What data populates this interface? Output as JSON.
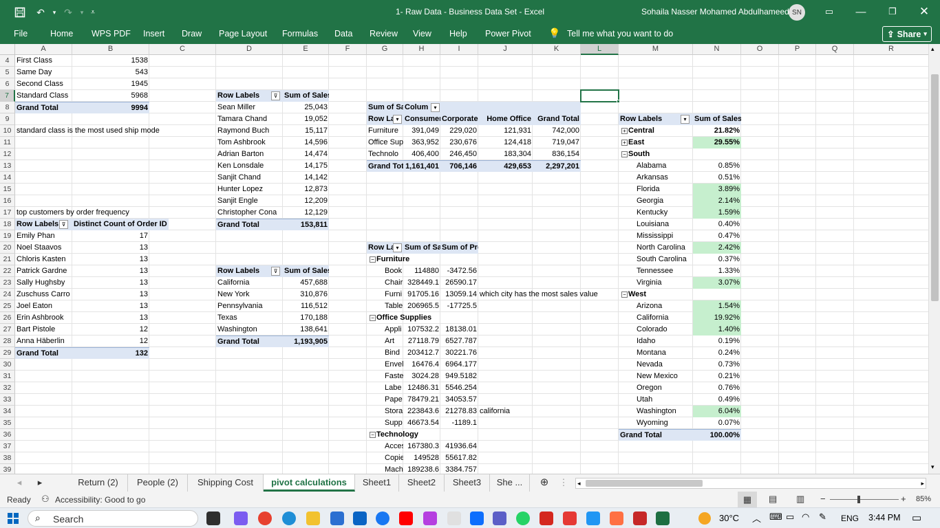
{
  "app": {
    "title": "1- Raw Data - Business Data Set  -  Excel",
    "user": "Sohaila Nasser Mohamed Abdulhameed",
    "user_initials": "SN",
    "accent": "#217346"
  },
  "menu": [
    "File",
    "Home",
    "WPS PDF",
    "Insert",
    "Draw",
    "Page Layout",
    "Formulas",
    "Data",
    "Review",
    "View",
    "Help",
    "Power Pivot"
  ],
  "tell_me": "Tell me what you want to do",
  "share_label": "Share",
  "columns": [
    "A",
    "B",
    "C",
    "D",
    "E",
    "F",
    "G",
    "H",
    "I",
    "J",
    "K",
    "L",
    "M",
    "N",
    "O",
    "P",
    "Q",
    "R"
  ],
  "rows": [
    "4",
    "5",
    "6",
    "7",
    "8",
    "9",
    "10",
    "11",
    "12",
    "13",
    "14",
    "15",
    "16",
    "17",
    "18",
    "19",
    "20",
    "21",
    "22",
    "23",
    "24",
    "25",
    "26",
    "27",
    "28",
    "29",
    "30",
    "31",
    "32",
    "33",
    "34",
    "35",
    "36",
    "37",
    "38",
    "39"
  ],
  "ship": {
    "rows": [
      [
        "First Class",
        "1538"
      ],
      [
        "Same Day",
        "543"
      ],
      [
        "Second Class",
        "1945"
      ],
      [
        "Standard Class",
        "5968"
      ]
    ],
    "total": [
      "Grand Total",
      "9994"
    ],
    "note": "standard class is the most used ship mode"
  },
  "orders": {
    "note": "top customers by order frequency",
    "header": [
      "Row Labels",
      "Distinct Count of Order ID"
    ],
    "rows": [
      [
        "Emily Phan",
        "17"
      ],
      [
        "Noel Staavos",
        "13"
      ],
      [
        "Chloris Kasten",
        "13"
      ],
      [
        "Patrick Gardne",
        "13"
      ],
      [
        "Sally Hughsby",
        "13"
      ],
      [
        "Zuschuss Carro",
        "13"
      ],
      [
        "Joel Eaton",
        "13"
      ],
      [
        "Erin Ashbrook",
        "13"
      ],
      [
        "Bart Pistole",
        "12"
      ],
      [
        "Anna Häberlin",
        "12"
      ]
    ],
    "total": [
      "Grand Total",
      "132"
    ]
  },
  "customers": {
    "header": [
      "Row Labels",
      "Sum of Sales"
    ],
    "rows": [
      [
        "Sean Miller",
        "25,043"
      ],
      [
        "Tamara Chand",
        "19,052"
      ],
      [
        "Raymond Buch",
        "15,117"
      ],
      [
        "Tom Ashbrook",
        "14,596"
      ],
      [
        "Adrian Barton",
        "14,474"
      ],
      [
        "Ken Lonsdale",
        "14,175"
      ],
      [
        "Sanjit Chand",
        "14,142"
      ],
      [
        "Hunter Lopez",
        "12,873"
      ],
      [
        "Sanjit Engle",
        "12,209"
      ],
      [
        "Christopher Cona",
        "12,129"
      ]
    ],
    "total": [
      "Grand Total",
      "153,811"
    ]
  },
  "states": {
    "header": [
      "Row Labels",
      "Sum of Sales"
    ],
    "rows": [
      [
        "California",
        "457,688"
      ],
      [
        "New York",
        "310,876"
      ],
      [
        "Pennsylvania",
        "116,512"
      ],
      [
        "Texas",
        "170,188"
      ],
      [
        "Washington",
        "138,641"
      ]
    ],
    "total": [
      "Grand Total",
      "1,193,905"
    ]
  },
  "segments": {
    "corner": "Sum of Sa",
    "col_labels": "Colum",
    "header": [
      "Row La",
      "Consumer",
      "Corporate",
      "Home Office",
      "Grand Total"
    ],
    "rows": [
      [
        "Furniture",
        "391,049",
        "229,020",
        "121,931",
        "742,000"
      ],
      [
        "Office Sup",
        "363,952",
        "230,676",
        "124,418",
        "719,047"
      ],
      [
        "Technolo",
        "406,400",
        "246,450",
        "183,304",
        "836,154"
      ]
    ],
    "total": [
      "Grand Tot",
      "1,161,401",
      "706,146",
      "429,653",
      "2,297,201"
    ]
  },
  "profit": {
    "header": [
      "Row La",
      "Sum of Sa",
      "Sum of Profit"
    ],
    "rows": [
      {
        "t": "g",
        "c": [
          "Furniture",
          "",
          ""
        ]
      },
      {
        "t": "i",
        "c": [
          "Book",
          "114880",
          "-3472.56"
        ]
      },
      {
        "t": "i",
        "c": [
          "Chair",
          "328449.1",
          "26590.17"
        ]
      },
      {
        "t": "i",
        "c": [
          "Furni",
          "91705.16",
          "13059.14"
        ]
      },
      {
        "t": "i",
        "c": [
          "Table",
          "206965.5",
          "-17725.5"
        ]
      },
      {
        "t": "g",
        "c": [
          "Office Supplies",
          "",
          ""
        ]
      },
      {
        "t": "i",
        "c": [
          "Appli",
          "107532.2",
          "18138.01"
        ]
      },
      {
        "t": "i",
        "c": [
          "Art",
          "27118.79",
          "6527.787"
        ]
      },
      {
        "t": "i",
        "c": [
          "Bind",
          "203412.7",
          "30221.76"
        ]
      },
      {
        "t": "i",
        "c": [
          "Envel",
          "16476.4",
          "6964.177"
        ]
      },
      {
        "t": "i",
        "c": [
          "Faste",
          "3024.28",
          "949.5182"
        ]
      },
      {
        "t": "i",
        "c": [
          "Labe",
          "12486.31",
          "5546.254"
        ]
      },
      {
        "t": "i",
        "c": [
          "Pape",
          "78479.21",
          "34053.57"
        ]
      },
      {
        "t": "i",
        "c": [
          "Stora",
          "223843.6",
          "21278.83"
        ]
      },
      {
        "t": "i",
        "c": [
          "Supp",
          "46673.54",
          "-1189.1"
        ]
      },
      {
        "t": "g",
        "c": [
          "Technology",
          "",
          ""
        ]
      },
      {
        "t": "i",
        "c": [
          "Acces",
          "167380.3",
          "41936.64"
        ]
      },
      {
        "t": "i",
        "c": [
          "Copie",
          "149528",
          "55617.82"
        ]
      },
      {
        "t": "i",
        "c": [
          "Mach",
          "189238.6",
          "3384.757"
        ]
      }
    ],
    "question": "which city has the most sales value",
    "answer": "california"
  },
  "regions": {
    "header": [
      "Row Labels",
      "Sum of Sales"
    ],
    "rows": [
      {
        "t": "g",
        "c": [
          "Central",
          "21.82%"
        ],
        "hl": false
      },
      {
        "t": "g",
        "c": [
          "East",
          "29.55%"
        ],
        "hl": true
      },
      {
        "t": "g",
        "c": [
          "South",
          ""
        ],
        "hl": false
      },
      {
        "t": "i",
        "c": [
          "Alabama",
          "0.85%"
        ],
        "hl": false
      },
      {
        "t": "i",
        "c": [
          "Arkansas",
          "0.51%"
        ],
        "hl": false
      },
      {
        "t": "i",
        "c": [
          "Florida",
          "3.89%"
        ],
        "hl": true
      },
      {
        "t": "i",
        "c": [
          "Georgia",
          "2.14%"
        ],
        "hl": true
      },
      {
        "t": "i",
        "c": [
          "Kentucky",
          "1.59%"
        ],
        "hl": true
      },
      {
        "t": "i",
        "c": [
          "Louisiana",
          "0.40%"
        ],
        "hl": false
      },
      {
        "t": "i",
        "c": [
          "Mississippi",
          "0.47%"
        ],
        "hl": false
      },
      {
        "t": "i",
        "c": [
          "North Carolina",
          "2.42%"
        ],
        "hl": true
      },
      {
        "t": "i",
        "c": [
          "South Carolina",
          "0.37%"
        ],
        "hl": false
      },
      {
        "t": "i",
        "c": [
          "Tennessee",
          "1.33%"
        ],
        "hl": false
      },
      {
        "t": "i",
        "c": [
          "Virginia",
          "3.07%"
        ],
        "hl": true
      },
      {
        "t": "g",
        "c": [
          "West",
          ""
        ],
        "hl": false
      },
      {
        "t": "i",
        "c": [
          "Arizona",
          "1.54%"
        ],
        "hl": true
      },
      {
        "t": "i",
        "c": [
          "California",
          "19.92%"
        ],
        "hl": true
      },
      {
        "t": "i",
        "c": [
          "Colorado",
          "1.40%"
        ],
        "hl": true
      },
      {
        "t": "i",
        "c": [
          "Idaho",
          "0.19%"
        ],
        "hl": false
      },
      {
        "t": "i",
        "c": [
          "Montana",
          "0.24%"
        ],
        "hl": false
      },
      {
        "t": "i",
        "c": [
          "Nevada",
          "0.73%"
        ],
        "hl": false
      },
      {
        "t": "i",
        "c": [
          "New Mexico",
          "0.21%"
        ],
        "hl": false
      },
      {
        "t": "i",
        "c": [
          "Oregon",
          "0.76%"
        ],
        "hl": false
      },
      {
        "t": "i",
        "c": [
          "Utah",
          "0.49%"
        ],
        "hl": false
      },
      {
        "t": "i",
        "c": [
          "Washington",
          "6.04%"
        ],
        "hl": true
      },
      {
        "t": "i",
        "c": [
          "Wyoming",
          "0.07%"
        ],
        "hl": false
      }
    ],
    "total": [
      "Grand Total",
      "100.00%"
    ]
  },
  "tabs": [
    "Return (2)",
    "People (2)",
    "Shipping Cost",
    "pivot calculations",
    "Sheet1",
    "Sheet2",
    "Sheet3",
    "She ..."
  ],
  "active_tab": "pivot calculations",
  "status": {
    "ready": "Ready",
    "accessibility": "Accessibility: Good to go",
    "zoom": "85%"
  },
  "taskbar": {
    "search": "Search",
    "temp": "30°C",
    "lang": "ENG",
    "time": "3:44 PM"
  }
}
